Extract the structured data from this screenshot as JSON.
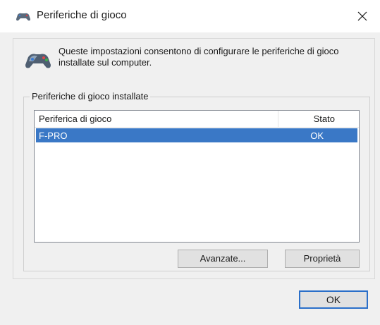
{
  "window": {
    "title": "Periferiche di gioco",
    "icon": "gamepad-icon",
    "close_icon": "close-icon"
  },
  "info": {
    "icon": "gamepad-icon",
    "text": "Queste impostazioni consentono di configurare le periferiche di gioco installate sul computer."
  },
  "devices_group": {
    "title": "Periferiche di gioco installate",
    "columns": [
      "Periferica di gioco",
      "Stato"
    ],
    "rows": [
      {
        "device": "F-PRO",
        "status": "OK",
        "selected": true
      }
    ]
  },
  "buttons": {
    "advanced": "Avanzate...",
    "properties": "Proprietà",
    "ok": "OK"
  },
  "colors": {
    "selection": "#3a78c6",
    "ok_border": "#2a6fc9",
    "dialog_bg": "#f0f0f0"
  }
}
